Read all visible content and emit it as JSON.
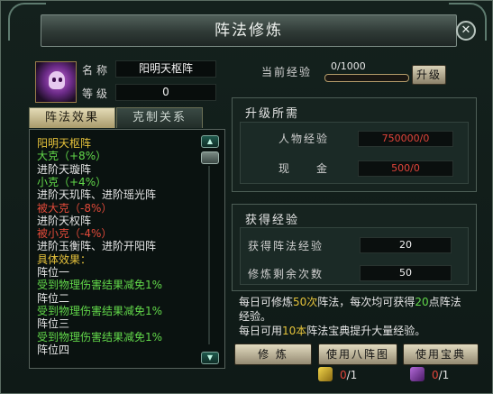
{
  "window": {
    "title": "阵法修炼"
  },
  "formation": {
    "name_label": "名称",
    "name_value": "阳明天枢阵",
    "level_label": "等级",
    "level_value": "0"
  },
  "tabs": [
    {
      "label": "阵法效果",
      "active": true
    },
    {
      "label": "克制关系",
      "active": false
    }
  ],
  "effects": [
    {
      "text": "阳明天枢阵",
      "color": "#e5c13b"
    },
    {
      "text": "大克（+8%）",
      "color": "#62d84a"
    },
    {
      "text": "进阶天璇阵",
      "color": "#e6e6e6"
    },
    {
      "text": "小克（+4%）",
      "color": "#62d84a"
    },
    {
      "text": "进阶天玑阵、进阶瑶光阵",
      "color": "#e6e6e6"
    },
    {
      "text": "被大克（-8%）",
      "color": "#e24a3a"
    },
    {
      "text": "进阶天权阵",
      "color": "#e6e6e6"
    },
    {
      "text": "被小克（-4%）",
      "color": "#e24a3a"
    },
    {
      "text": "进阶玉衡阵、进阶开阳阵",
      "color": "#e6e6e6"
    },
    {
      "text": "具体效果：",
      "color": "#e5c13b"
    },
    {
      "text": "阵位一",
      "color": "#e6e6e6"
    },
    {
      "text": "受到物理伤害结果减免1%",
      "color": "#62d84a"
    },
    {
      "text": "阵位二",
      "color": "#e6e6e6"
    },
    {
      "text": "受到物理伤害结果减免1%",
      "color": "#62d84a"
    },
    {
      "text": "阵位三",
      "color": "#e6e6e6"
    },
    {
      "text": "受到物理伤害结果减免1%",
      "color": "#62d84a"
    },
    {
      "text": "阵位四",
      "color": "#e6e6e6"
    }
  ],
  "current_exp": {
    "label": "当前经验",
    "value": "0/1000",
    "progress": 0,
    "upgrade_button": "升级"
  },
  "upgrade_req": {
    "title": "升级所需",
    "exp_label": "人物经验",
    "exp_value": "750000/0",
    "money_label": "现　　金",
    "money_value": "500/0"
  },
  "gain_exp": {
    "title": "获得经验",
    "gain_label": "获得阵法经验",
    "gain_value": "20",
    "remain_label": "修炼剩余次数",
    "remain_value": "50"
  },
  "info": {
    "line1_a": "每日可修炼",
    "line1_b": "50次",
    "line1_c": "阵法，每次均可获得",
    "line1_d": "20",
    "line1_e": "点阵法",
    "line2": "经验。",
    "line3_a": "每日可用",
    "line3_b": "10本",
    "line3_c": "阵法宝典提升大量经验。"
  },
  "buttons": {
    "train": "修 炼",
    "use_chart": "使用八阵图",
    "use_book": "使用宝典"
  },
  "items": {
    "chart_count": "0",
    "chart_total": "/1",
    "book_count": "0",
    "book_total": "/1"
  },
  "colors": {
    "accent_gold": "#e5c13b",
    "accent_green": "#62d84a",
    "accent_red": "#e24a3a"
  }
}
